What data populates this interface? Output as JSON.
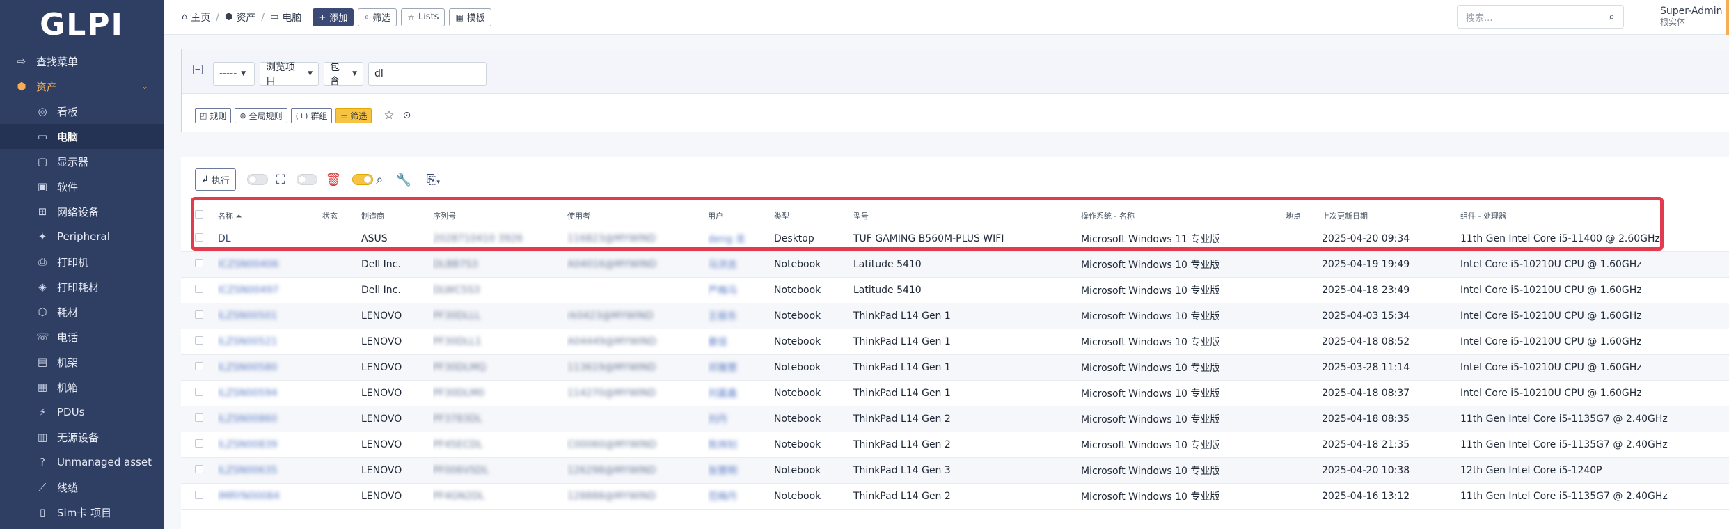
{
  "app": {
    "logo": "GLPI"
  },
  "sidebar": {
    "find_menu": "查找菜单",
    "section": "资产",
    "items": [
      {
        "label": "看板",
        "icon": "gauge-icon",
        "glyph": "◎"
      },
      {
        "label": "电脑",
        "icon": "laptop-icon",
        "glyph": "▭",
        "active": true
      },
      {
        "label": "显示器",
        "icon": "monitor-icon",
        "glyph": "▢"
      },
      {
        "label": "软件",
        "icon": "software-icon",
        "glyph": "▣"
      },
      {
        "label": "网络设备",
        "icon": "network-icon",
        "glyph": "⊞"
      },
      {
        "label": "Peripheral",
        "icon": "peripheral-icon",
        "glyph": "✦"
      },
      {
        "label": "打印机",
        "icon": "printer-icon",
        "glyph": "⎙"
      },
      {
        "label": "打印耗材",
        "icon": "cartridge-icon",
        "glyph": "◈"
      },
      {
        "label": "耗材",
        "icon": "consumable-icon",
        "glyph": "⬡"
      },
      {
        "label": "电话",
        "icon": "phone-icon",
        "glyph": "☏"
      },
      {
        "label": "机架",
        "icon": "rack-icon",
        "glyph": "▤"
      },
      {
        "label": "机箱",
        "icon": "enclosure-icon",
        "glyph": "▦"
      },
      {
        "label": "PDUs",
        "icon": "pdu-icon",
        "glyph": "⚡"
      },
      {
        "label": "无源设备",
        "icon": "passive-device-icon",
        "glyph": "▥"
      },
      {
        "label": "Unmanaged asset",
        "icon": "question-icon",
        "glyph": "?"
      },
      {
        "label": "线缆",
        "icon": "cable-icon",
        "glyph": "⟋"
      },
      {
        "label": "Sim卡 项目",
        "icon": "sim-card-icon",
        "glyph": "▯"
      }
    ]
  },
  "breadcrumb": {
    "home": "主页",
    "assets": "资产",
    "computers": "电脑"
  },
  "toolbar": {
    "add": "添加",
    "filter": "筛选",
    "lists": "Lists",
    "templates": "模板"
  },
  "search": {
    "placeholder": "搜索..."
  },
  "user": {
    "name": "Super-Admin",
    "entity": "根实体"
  },
  "criteria": {
    "link": "-----",
    "field": "浏览项目",
    "operator": "包含",
    "value": "dl",
    "buttons": {
      "rule": "规则",
      "global_rule": "全局规则",
      "group": "群组",
      "filter": "筛选"
    }
  },
  "actions": {
    "execute": "执行"
  },
  "table": {
    "columns": [
      "名称",
      "状态",
      "制造商",
      "序列号",
      "使用者",
      "用户",
      "类型",
      "型号",
      "操作系统 - 名称",
      "地点",
      "上次更新日期",
      "组件 - 处理器"
    ],
    "rows": [
      {
        "name": "DL",
        "manufacturer": "ASUS",
        "serial": "2028710410 3926",
        "using": "116823@MYWIND",
        "user": "deng 龙",
        "type": "Desktop",
        "model": "TUF GAMING B560M-PLUS WIFI",
        "os": "Microsoft Windows 11 专业版",
        "updated": "2025-04-20 09:34",
        "cpu": "11th Gen Intel Core i5-11400 @ 2.60GHz"
      },
      {
        "name": "ICZSN00406",
        "manufacturer": "Dell Inc.",
        "serial": "DLBB7S3",
        "using": "A04016@MYWIND",
        "user": "马洪吉",
        "type": "Notebook",
        "model": "Latitude 5410",
        "os": "Microsoft Windows 10 专业版",
        "updated": "2025-04-19 19:49",
        "cpu": "Intel Core i5-10210U CPU @ 1.60GHz"
      },
      {
        "name": "ICZSN00497",
        "manufacturer": "Dell Inc.",
        "serial": "DLWC5S3",
        "using": "",
        "user": "严梅马",
        "type": "Notebook",
        "model": "Latitude 5410",
        "os": "Microsoft Windows 10 专业版",
        "updated": "2025-04-18 23:49",
        "cpu": "Intel Core i5-10210U CPU @ 1.60GHz"
      },
      {
        "name": "ILZSN00501",
        "manufacturer": "LENOVO",
        "serial": "PF30DLLL",
        "using": "rk0423@MYWIND",
        "user": "王振东",
        "type": "Notebook",
        "model": "ThinkPad L14 Gen 1",
        "os": "Microsoft Windows 10 专业版",
        "updated": "2025-04-03 15:34",
        "cpu": "Intel Core i5-10210U CPU @ 1.60GHz"
      },
      {
        "name": "ILZSN00521",
        "manufacturer": "LENOVO",
        "serial": "PF30DLL1",
        "using": "A04449@MYWIND",
        "user": "娄佳",
        "type": "Notebook",
        "model": "ThinkPad L14 Gen 1",
        "os": "Microsoft Windows 10 专业版",
        "updated": "2025-04-18 08:52",
        "cpu": "Intel Core i5-10210U CPU @ 1.60GHz"
      },
      {
        "name": "ILZSN00580",
        "manufacturer": "LENOVO",
        "serial": "PF30DLMQ",
        "using": "113619@MYWIND",
        "user": "邓雅慧",
        "type": "Notebook",
        "model": "ThinkPad L14 Gen 1",
        "os": "Microsoft Windows 10 专业版",
        "updated": "2025-03-28 11:14",
        "cpu": "Intel Core i5-10210U CPU @ 1.60GHz"
      },
      {
        "name": "ILZSN00594",
        "manufacturer": "LENOVO",
        "serial": "PF30DLM0",
        "using": "114270@MYWIND",
        "user": "刘嘉鑫",
        "type": "Notebook",
        "model": "ThinkPad L14 Gen 1",
        "os": "Microsoft Windows 10 专业版",
        "updated": "2025-04-18 08:37",
        "cpu": "Intel Core i5-10210U CPU @ 1.60GHz"
      },
      {
        "name": "ILZSN00860",
        "manufacturer": "LENOVO",
        "serial": "PF3783DL",
        "using": "",
        "user": "刘丹",
        "type": "Notebook",
        "model": "ThinkPad L14 Gen 2",
        "os": "Microsoft Windows 10 专业版",
        "updated": "2025-04-18 08:35",
        "cpu": "11th Gen Intel Core i5-1135G7 @ 2.40GHz"
      },
      {
        "name": "ILZSN00839",
        "manufacturer": "LENOVO",
        "serial": "PF45ECDL",
        "using": "C00060@MYWIND",
        "user": "陈炜钊",
        "type": "Notebook",
        "model": "ThinkPad L14 Gen 2",
        "os": "Microsoft Windows 10 专业版",
        "updated": "2025-04-18 21:35",
        "cpu": "11th Gen Intel Core i5-1135G7 @ 2.40GHz"
      },
      {
        "name": "ILZSN00635",
        "manufacturer": "LENOVO",
        "serial": "PF006VSDL",
        "using": "126298@MYWIND",
        "user": "张慧明",
        "type": "Notebook",
        "model": "ThinkPad L14 Gen 3",
        "os": "Microsoft Windows 10 专业版",
        "updated": "2025-04-20 10:38",
        "cpu": "12th Gen Intel Core i5-1240P"
      },
      {
        "name": "IMRYN00084",
        "manufacturer": "LENOVO",
        "serial": "PF4GN2DL",
        "using": "128888@MYWIND",
        "user": "范梅丹",
        "type": "Notebook",
        "model": "ThinkPad L14 Gen 2",
        "os": "Microsoft Windows 10 专业版",
        "updated": "2025-04-16 13:12",
        "cpu": "11th Gen Intel Core i5-1135G7 @ 2.40GHz"
      }
    ]
  },
  "colors": {
    "sidebar": "#2f3f64",
    "accent": "#f6ad55",
    "primary": "#3a4a75",
    "highlight": "#e23a4f"
  }
}
